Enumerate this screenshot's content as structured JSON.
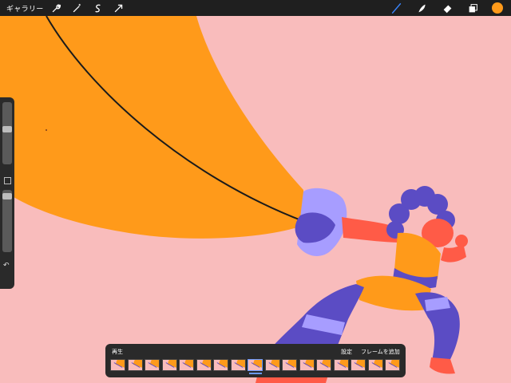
{
  "topbar": {
    "gallery_label": "ギャラリー",
    "left_tools": [
      {
        "name": "wrench-icon"
      },
      {
        "name": "magic-wand-icon"
      },
      {
        "name": "selection-icon"
      },
      {
        "name": "transform-icon"
      }
    ],
    "right_tools": [
      {
        "name": "brush-icon"
      },
      {
        "name": "smudge-icon"
      },
      {
        "name": "eraser-icon"
      },
      {
        "name": "layers-icon"
      }
    ],
    "current_color": "#ff9a1a"
  },
  "timeline": {
    "play_label": "再生",
    "settings_label": "設定",
    "add_frame_label": "フレームを追加",
    "frame_count": 17,
    "active_frame_index": 8
  },
  "colors": {
    "background": "#f9bcbc",
    "orange": "#ff9a1a",
    "purple": "#5b4cc4",
    "lavender": "#a79dff",
    "skin": "#ff5b47",
    "accent_blue": "#3a86ff"
  }
}
